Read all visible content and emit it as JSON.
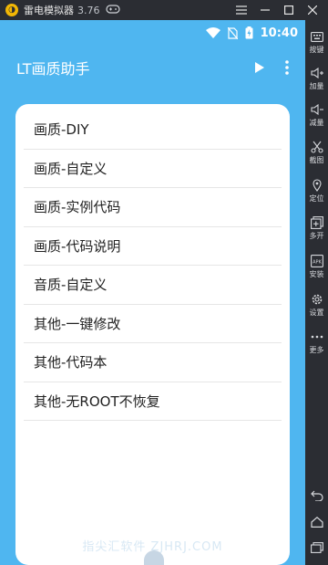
{
  "emulator": {
    "title": "雷电模拟器",
    "version": "3.76"
  },
  "statusbar": {
    "time": "10:40"
  },
  "app": {
    "title": "LT画质助手"
  },
  "menu": [
    {
      "label": "画质-DIY"
    },
    {
      "label": "画质-自定义"
    },
    {
      "label": "画质-实例代码"
    },
    {
      "label": "画质-代码说明"
    },
    {
      "label": "音质-自定义"
    },
    {
      "label": "其他-一键修改"
    },
    {
      "label": "其他-代码本"
    },
    {
      "label": "其他-无ROOT不恢复"
    }
  ],
  "watermark": "指尖汇软件 ZJHRJ.COM",
  "sidebar": [
    {
      "label": "按键",
      "icon": "keyboard-icon"
    },
    {
      "label": "加量",
      "icon": "volume-up-icon"
    },
    {
      "label": "减量",
      "icon": "volume-down-icon"
    },
    {
      "label": "截图",
      "icon": "scissors-icon"
    },
    {
      "label": "定位",
      "icon": "location-icon"
    },
    {
      "label": "多开",
      "icon": "multi-instance-icon"
    },
    {
      "label": "安装",
      "icon": "apk-install-icon"
    },
    {
      "label": "设置",
      "icon": "gear-icon"
    },
    {
      "label": "更多",
      "icon": "more-icon"
    }
  ],
  "colors": {
    "app_background": "#4fb6f0",
    "card": "#ffffff",
    "emulator_chrome": "#2b2d33"
  }
}
